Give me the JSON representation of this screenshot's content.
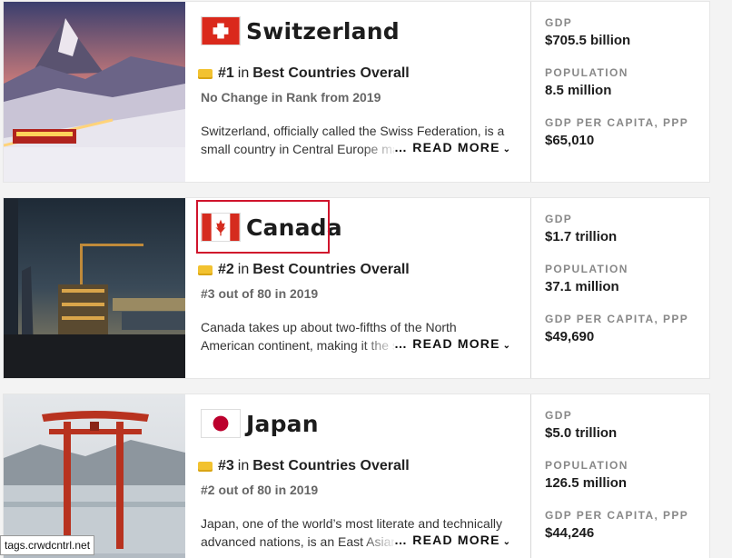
{
  "countries": [
    {
      "name": "Switzerland",
      "flag_icon": "swiss-flag-icon",
      "rank": "#1",
      "in": "in",
      "category": "Best Countries Overall",
      "change": "No Change in Rank from 2019",
      "description": "Switzerland, officially called the Swiss Federation, is a small country in Central Europe ma",
      "read_more": "… READ MORE",
      "stats": [
        {
          "label": "GDP",
          "value": "$705.5 billion"
        },
        {
          "label": "POPULATION",
          "value": "8.5 million"
        },
        {
          "label": "GDP PER CAPITA, PPP",
          "value": "$65,010"
        }
      ]
    },
    {
      "name": "Canada",
      "flag_icon": "canada-flag-icon",
      "rank": "#2",
      "in": "in",
      "category": "Best Countries Overall",
      "change": "#3 out of 80 in 2019",
      "description": "Canada takes up about two-fifths of the North American continent, making it the second-lar",
      "read_more": "… READ MORE",
      "stats": [
        {
          "label": "GDP",
          "value": "$1.7 trillion"
        },
        {
          "label": "POPULATION",
          "value": "37.1 million"
        },
        {
          "label": "GDP PER CAPITA, PPP",
          "value": "$49,690"
        }
      ]
    },
    {
      "name": "Japan",
      "flag_icon": "japan-flag-icon",
      "rank": "#3",
      "in": "in",
      "category": "Best Countries Overall",
      "change": "#2 out of 80 in 2019",
      "description": "Japan, one of the world’s most literate and technically advanced nations, is an East Asian",
      "read_more": "… READ MORE",
      "stats": [
        {
          "label": "GDP",
          "value": "$5.0 trillion"
        },
        {
          "label": "POPULATION",
          "value": "126.5 million"
        },
        {
          "label": "GDP PER CAPITA, PPP",
          "value": "$44,246"
        }
      ]
    }
  ],
  "status_tooltip": "tags.crwdcntrl.net",
  "colors": {
    "swiss_red": "#da291c",
    "canada_red": "#d52b1e",
    "japan_red": "#bc002d",
    "highlight_border": "#d0142c",
    "medal": "#f2c230"
  }
}
